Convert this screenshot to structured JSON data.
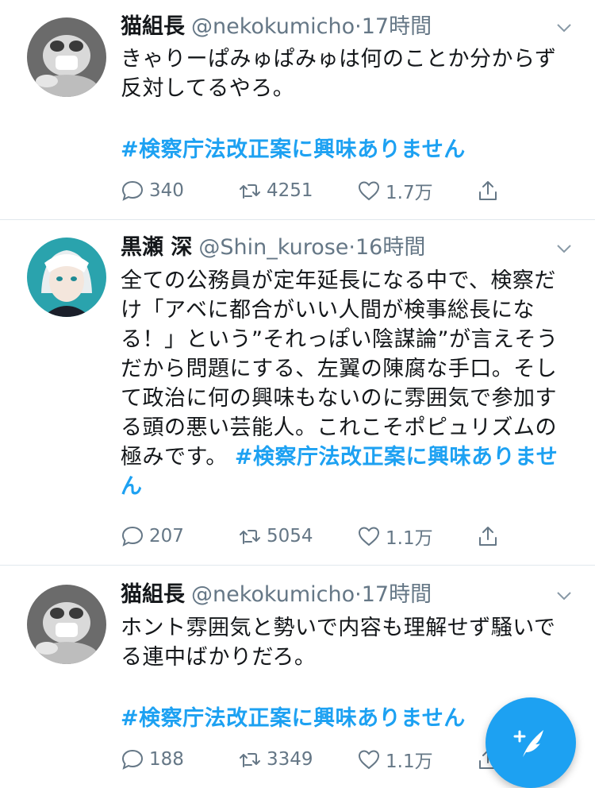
{
  "tweets": [
    {
      "name": "猫組長",
      "handle": "@nekokumicho",
      "dot": "·",
      "time": "17時間",
      "lines": [
        "きゃりーぱみゅぱみゅは何のことか分からず",
        "反対してるやろ。"
      ],
      "hashtag": "#検察庁法改正案に興味ありません",
      "replies": "340",
      "retweets": "4251",
      "likes": "1.7万"
    },
    {
      "name": "黒瀬 深",
      "handle": "@Shin_kurose",
      "dot": "·",
      "time": "16時間",
      "lines": [
        "全ての公務員が定年延長になる中で、検察だ",
        "け「アベに都合がいい人間が検事総長にな",
        "る！」という”それっぽい陰謀論”が言えそう",
        "だから問題にする、左翼の陳腐な手口。そし",
        "て政治に何の興味もないのに雰囲気で参加す",
        "る頭の悪い芸能人。これこそポピュリズムの"
      ],
      "last_line": "極みです。",
      "hashtag_a": "#検察庁法改正案に興味ありませ",
      "hashtag_b": "ん",
      "replies": "207",
      "retweets": "5054",
      "likes": "1.1万"
    },
    {
      "name": "猫組長",
      "handle": "@nekokumicho",
      "dot": "·",
      "time": "17時間",
      "lines": [
        "ホント雰囲気と勢いで内容も理解せず騒いで",
        "る連中ばかりだろ。"
      ],
      "hashtag": "#検察庁法改正案に興味ありません",
      "replies": "188",
      "retweets": "3349",
      "likes": "1.1万"
    }
  ],
  "colors": {
    "accent": "#1da1f2",
    "muted": "#657786",
    "text": "#14171a",
    "divider": "#e1e8ed"
  },
  "icons": {
    "reply": "reply-icon",
    "retweet": "retweet-icon",
    "like": "like-icon",
    "share": "share-icon",
    "compose": "compose-tweet-icon"
  }
}
